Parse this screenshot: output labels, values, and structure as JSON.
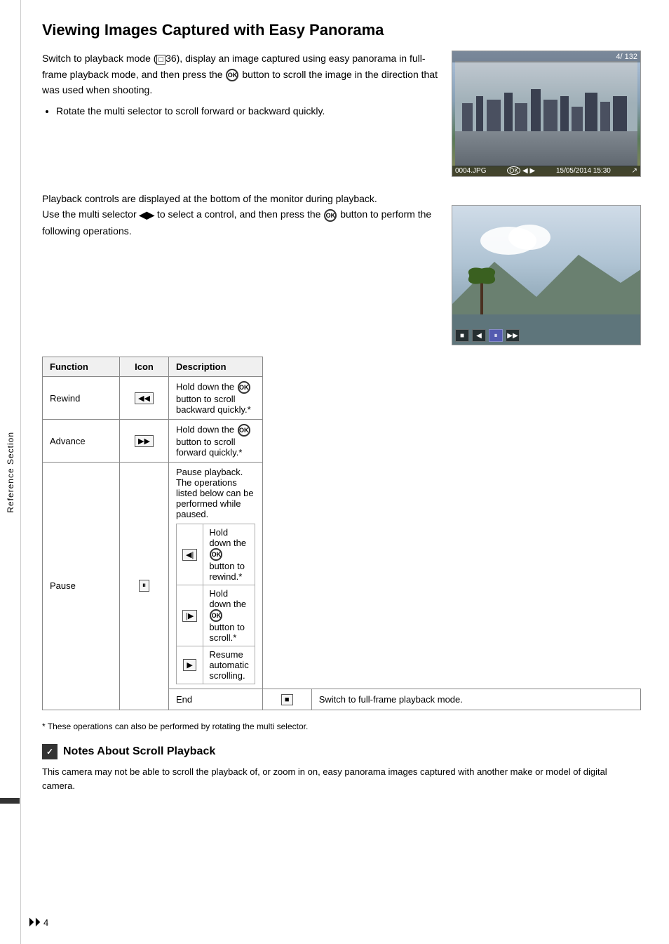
{
  "page": {
    "title": "Viewing Images Captured with Easy Panorama",
    "sidebar_label": "Reference Section",
    "page_number": "4"
  },
  "intro": {
    "paragraph1": "Switch to playback mode (",
    "page_ref": "36",
    "paragraph1b": "), display an image captured using easy panorama in full-frame playback mode, and then press the ",
    "ok_btn": "OK",
    "paragraph1c": " button to scroll the image in the direction that was used when shooting.",
    "bullet1": "Rotate the multi selector to scroll forward or backward quickly.",
    "camera_info": {
      "frame": "4/ 132",
      "filename": "0004.JPG",
      "ok_label": "OK",
      "date": "15/05/2014 15:30"
    }
  },
  "playback_section": {
    "line1": "Playback controls are displayed at the bottom of the monitor during playback.",
    "line2": "Use the multi selector ◀▶ to select a control, and then press the ",
    "ok_label": "OK",
    "line2b": " button to perform the following operations."
  },
  "table": {
    "headers": {
      "function": "Function",
      "icon": "Icon",
      "description": "Description"
    },
    "rows": [
      {
        "function": "Rewind",
        "icon": "◀◀",
        "icon_type": "rewind",
        "description": "Hold down the OK button to scroll backward quickly.*",
        "sub_rows": []
      },
      {
        "function": "Advance",
        "icon": "▶▶",
        "icon_type": "advance",
        "description": "Hold down the OK button to scroll forward quickly.*",
        "sub_rows": []
      },
      {
        "function": "Pause",
        "icon": "⏸",
        "icon_type": "pause",
        "description": "Pause playback. The operations listed below can be performed while paused.",
        "sub_rows": [
          {
            "icon": "◀|",
            "icon_type": "frame-rewind",
            "text": "Hold down the OK button to rewind.*"
          },
          {
            "icon": "|▶",
            "icon_type": "frame-advance",
            "text": "Hold down the OK button to scroll.*"
          },
          {
            "icon": "▶",
            "icon_type": "play",
            "text": "Resume automatic scrolling."
          }
        ]
      },
      {
        "function": "End",
        "icon": "■",
        "icon_type": "stop",
        "description": "Switch to full-frame playback mode.",
        "sub_rows": []
      }
    ]
  },
  "footnote": "*  These operations can also be performed by rotating the multi selector.",
  "notes": {
    "title": "Notes About Scroll Playback",
    "icon": "✓",
    "body": "This camera may not be able to scroll the playback of, or zoom in on, easy panorama images captured with another make or model of digital camera."
  },
  "controls": {
    "stop": "■",
    "rewind": "◀◀",
    "pause": "⏸",
    "advance": "▶▶"
  }
}
